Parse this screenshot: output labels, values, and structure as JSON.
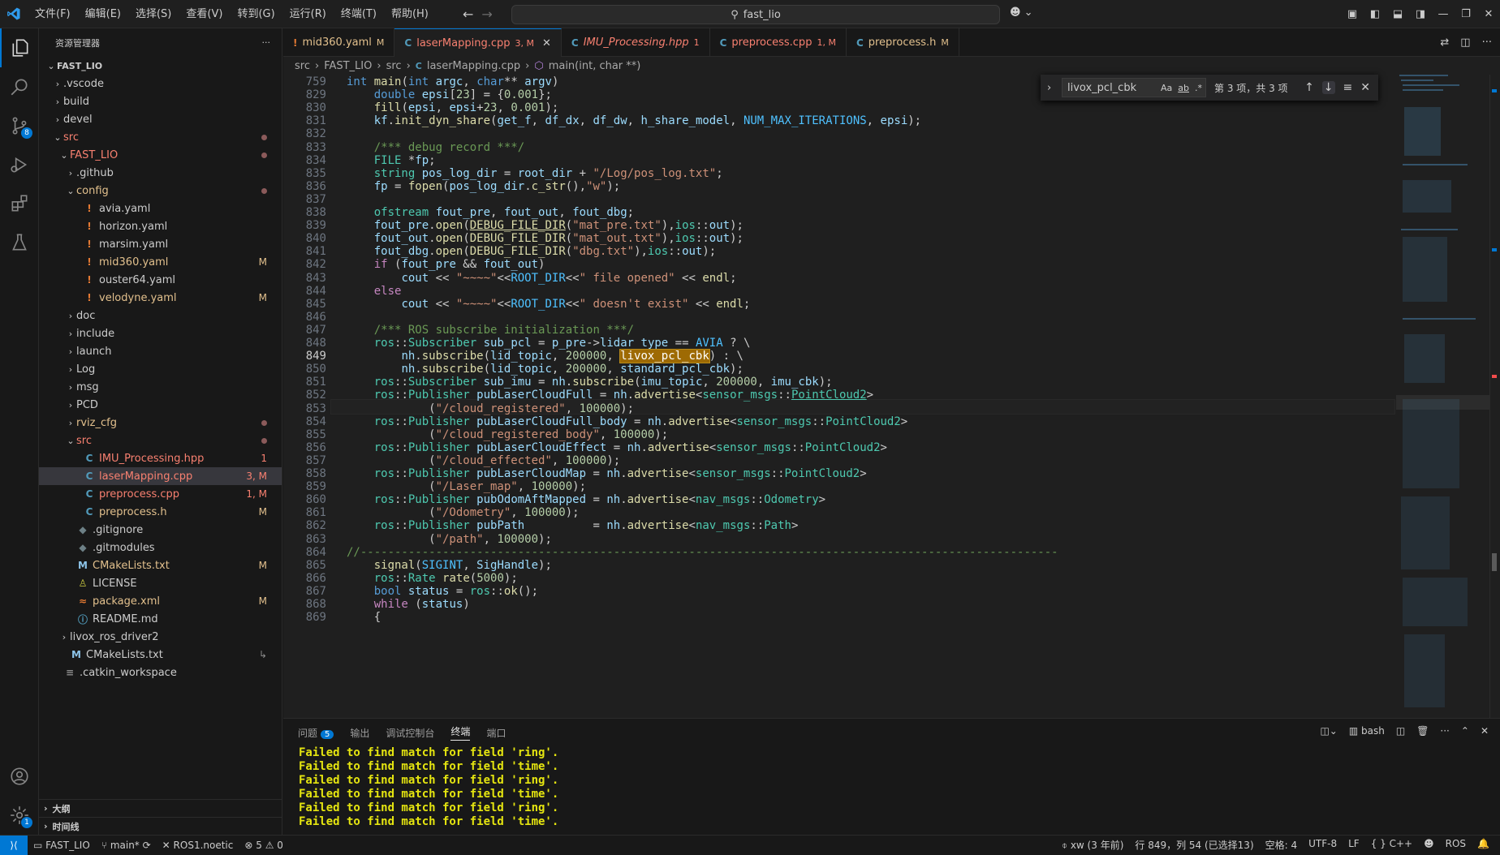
{
  "title_bar": {
    "menu": [
      "文件(F)",
      "编辑(E)",
      "选择(S)",
      "查看(V)",
      "转到(G)",
      "运行(R)",
      "终端(T)",
      "帮助(H)"
    ],
    "search": "fast_lio"
  },
  "activity_bar": {
    "source_control_badge": "8",
    "settings_badge": "1"
  },
  "explorer": {
    "header": "资源管理器",
    "more": "···",
    "rows": [
      {
        "label": "FAST_LIO",
        "indent": 0,
        "chev": "v",
        "icon": "",
        "status": "",
        "cls": "",
        "bold": true
      },
      {
        "label": ".vscode",
        "indent": 1,
        "chev": ">",
        "icon": "",
        "status": "",
        "cls": ""
      },
      {
        "label": "build",
        "indent": 1,
        "chev": ">",
        "icon": "",
        "status": "",
        "cls": ""
      },
      {
        "label": "devel",
        "indent": 1,
        "chev": ">",
        "icon": "",
        "status": "",
        "cls": ""
      },
      {
        "label": "src",
        "indent": 1,
        "chev": "v",
        "icon": "",
        "status": "",
        "cls": "err",
        "dot": true
      },
      {
        "label": "FAST_LIO",
        "indent": 2,
        "chev": "v",
        "icon": "",
        "status": "",
        "cls": "err",
        "dot": true
      },
      {
        "label": ".github",
        "indent": 3,
        "chev": ">",
        "icon": "",
        "status": "",
        "cls": ""
      },
      {
        "label": "config",
        "indent": 3,
        "chev": "v",
        "icon": "",
        "status": "",
        "cls": "mod",
        "dot": true
      },
      {
        "label": "avia.yaml",
        "indent": 4,
        "chev": "",
        "icon": "!",
        "status": "",
        "cls": ""
      },
      {
        "label": "horizon.yaml",
        "indent": 4,
        "chev": "",
        "icon": "!",
        "status": "",
        "cls": ""
      },
      {
        "label": "marsim.yaml",
        "indent": 4,
        "chev": "",
        "icon": "!",
        "status": "",
        "cls": ""
      },
      {
        "label": "mid360.yaml",
        "indent": 4,
        "chev": "",
        "icon": "!",
        "status": "M",
        "cls": "mod"
      },
      {
        "label": "ouster64.yaml",
        "indent": 4,
        "chev": "",
        "icon": "!",
        "status": "",
        "cls": ""
      },
      {
        "label": "velodyne.yaml",
        "indent": 4,
        "chev": "",
        "icon": "!",
        "status": "M",
        "cls": "mod"
      },
      {
        "label": "doc",
        "indent": 3,
        "chev": ">",
        "icon": "",
        "status": "",
        "cls": ""
      },
      {
        "label": "include",
        "indent": 3,
        "chev": ">",
        "icon": "",
        "status": "",
        "cls": ""
      },
      {
        "label": "launch",
        "indent": 3,
        "chev": ">",
        "icon": "",
        "status": "",
        "cls": ""
      },
      {
        "label": "Log",
        "indent": 3,
        "chev": ">",
        "icon": "",
        "status": "",
        "cls": ""
      },
      {
        "label": "msg",
        "indent": 3,
        "chev": ">",
        "icon": "",
        "status": "",
        "cls": ""
      },
      {
        "label": "PCD",
        "indent": 3,
        "chev": ">",
        "icon": "",
        "status": "",
        "cls": ""
      },
      {
        "label": "rviz_cfg",
        "indent": 3,
        "chev": ">",
        "icon": "",
        "status": "",
        "cls": "mod",
        "dot": true
      },
      {
        "label": "src",
        "indent": 3,
        "chev": "v",
        "icon": "",
        "status": "",
        "cls": "err",
        "dot": true
      },
      {
        "label": "IMU_Processing.hpp",
        "indent": 4,
        "chev": "",
        "icon": "C",
        "status": "1",
        "cls": "err"
      },
      {
        "label": "laserMapping.cpp",
        "indent": 4,
        "chev": "",
        "icon": "C",
        "status": "3, M",
        "cls": "err",
        "sel": true
      },
      {
        "label": "preprocess.cpp",
        "indent": 4,
        "chev": "",
        "icon": "C",
        "status": "1, M",
        "cls": "err"
      },
      {
        "label": "preprocess.h",
        "indent": 4,
        "chev": "",
        "icon": "C",
        "status": "M",
        "cls": "mod"
      },
      {
        "label": ".gitignore",
        "indent": 3,
        "chev": "",
        "icon": "◆",
        "status": "",
        "cls": ""
      },
      {
        "label": ".gitmodules",
        "indent": 3,
        "chev": "",
        "icon": "◆",
        "status": "",
        "cls": ""
      },
      {
        "label": "CMakeLists.txt",
        "indent": 3,
        "chev": "",
        "icon": "M",
        "status": "M",
        "cls": "mod"
      },
      {
        "label": "LICENSE",
        "indent": 3,
        "chev": "",
        "icon": "♙",
        "status": "",
        "cls": ""
      },
      {
        "label": "package.xml",
        "indent": 3,
        "chev": "",
        "icon": "≈",
        "status": "M",
        "cls": "mod"
      },
      {
        "label": "README.md",
        "indent": 3,
        "chev": "",
        "icon": "ⓘ",
        "status": "",
        "cls": ""
      },
      {
        "label": "livox_ros_driver2",
        "indent": 2,
        "chev": ">",
        "icon": "",
        "status": "",
        "cls": ""
      },
      {
        "label": "CMakeLists.txt",
        "indent": 2,
        "chev": "",
        "icon": "M",
        "status": "↳",
        "cls": ""
      },
      {
        "label": ".catkin_workspace",
        "indent": 1,
        "chev": "",
        "icon": "≡",
        "status": "",
        "cls": ""
      }
    ],
    "outline": "大纲",
    "timeline": "时间线"
  },
  "tabs": [
    {
      "label": "mid360.yaml",
      "status": "M",
      "icon": "!",
      "cls": "mod",
      "italic": false
    },
    {
      "label": "laserMapping.cpp",
      "status": "3, M",
      "icon": "C",
      "cls": "err",
      "italic": false,
      "active": true
    },
    {
      "label": "IMU_Processing.hpp",
      "status": "1",
      "icon": "C",
      "cls": "err",
      "italic": true
    },
    {
      "label": "preprocess.cpp",
      "status": "1, M",
      "icon": "C",
      "cls": "err",
      "italic": false
    },
    {
      "label": "preprocess.h",
      "status": "M",
      "icon": "C",
      "cls": "mod",
      "italic": false
    }
  ],
  "breadcrumb": [
    "src",
    "FAST_LIO",
    "src",
    "laserMapping.cpp",
    "main(int, char **)"
  ],
  "find": {
    "query": "livox_pcl_cbk",
    "opt_case": "Aa",
    "opt_word": "ab",
    "opt_regex": ".*",
    "result": "第 3 项，共 3 项"
  },
  "editor": {
    "current_line": "849",
    "highlight": "livox_pcl_cbk",
    "lines": [
      {
        "n": "759",
        "html": "<span class='k'>int</span> <span class='f'>main</span>(<span class='k'>int</span> <span class='v'>argc</span>, <span class='k'>char</span>** <span class='v'>argv</span>)"
      },
      {
        "n": "829",
        "html": "    <span class='k'>double</span> <span class='v'>epsi</span>[<span class='n'>23</span>] = {<span class='n'>0.001</span>};"
      },
      {
        "n": "830",
        "html": "    <span class='f'>fill</span>(<span class='v'>epsi</span>, <span class='v'>epsi</span>+<span class='n'>23</span>, <span class='n'>0.001</span>);"
      },
      {
        "n": "831",
        "html": "    <span class='v'>kf</span>.<span class='f'>init_dyn_share</span>(<span class='v'>get_f</span>, <span class='v'>df_dx</span>, <span class='v'>df_dw</span>, <span class='v'>h_share_model</span>, <span class='m'>NUM_MAX_ITERATIONS</span>, <span class='v'>epsi</span>);"
      },
      {
        "n": "832",
        "html": ""
      },
      {
        "n": "833",
        "html": "    <span class='c'>/*** debug record ***/</span>"
      },
      {
        "n": "834",
        "html": "    <span class='t'>FILE</span> *<span class='v'>fp</span>;"
      },
      {
        "n": "835",
        "html": "    <span class='t'>string</span> <span class='v'>pos_log_dir</span> = <span class='v'>root_dir</span> + <span class='s'>\"/Log/pos_log.txt\"</span>;"
      },
      {
        "n": "836",
        "html": "    <span class='v'>fp</span> = <span class='f'>fopen</span>(<span class='v'>pos_log_dir</span>.<span class='f'>c_str</span>(),<span class='s'>\"w\"</span>);"
      },
      {
        "n": "837",
        "html": ""
      },
      {
        "n": "838",
        "html": "    <span class='t'>ofstream</span> <span class='v'>fout_pre</span>, <span class='v'>fout_out</span>, <span class='v'>fout_dbg</span>;"
      },
      {
        "n": "839",
        "html": "    <span class='v'>fout_pre</span>.<span class='f'>open</span>(<span class='f ul'>DEBUG_FILE_DIR</span>(<span class='s'>\"mat_pre.txt\"</span>),<span class='t'>ios</span>::<span class='v'>out</span>);"
      },
      {
        "n": "840",
        "html": "    <span class='v'>fout_out</span>.<span class='f'>open</span>(<span class='f'>DEBUG_FILE_DIR</span>(<span class='s'>\"mat_out.txt\"</span>),<span class='t'>ios</span>::<span class='v'>out</span>);"
      },
      {
        "n": "841",
        "html": "    <span class='v'>fout_dbg</span>.<span class='f'>open</span>(<span class='f'>DEBUG_FILE_DIR</span>(<span class='s'>\"dbg.txt\"</span>),<span class='t'>ios</span>::<span class='v'>out</span>);"
      },
      {
        "n": "842",
        "html": "    <span class='e'>if</span> (<span class='v'>fout_pre</span> &amp;&amp; <span class='v'>fout_out</span>)"
      },
      {
        "n": "843",
        "html": "        <span class='v'>cout</span> &lt;&lt; <span class='s'>\"~~~~\"</span>&lt;&lt;<span class='m'>ROOT_DIR</span>&lt;&lt;<span class='s'>\" file opened\"</span> &lt;&lt; <span class='f'>endl</span>;"
      },
      {
        "n": "844",
        "html": "    <span class='e'>else</span>"
      },
      {
        "n": "845",
        "html": "        <span class='v'>cout</span> &lt;&lt; <span class='s'>\"~~~~\"</span>&lt;&lt;<span class='m'>ROOT_DIR</span>&lt;&lt;<span class='s'>\" doesn't exist\"</span> &lt;&lt; <span class='f'>endl</span>;"
      },
      {
        "n": "846",
        "html": ""
      },
      {
        "n": "847",
        "html": "    <span class='c'>/*** ROS subscribe initialization ***/</span>"
      },
      {
        "n": "848",
        "html": "    <span class='t'>ros</span>::<span class='t'>Subscriber</span> <span class='v'>sub_pcl</span> = <span class='v'>p_pre</span>-&gt;<span class='v'>lidar_type</span> == <span class='m'>AVIA</span> ? \\"
      },
      {
        "n": "849",
        "html": "        <span class='v'>nh</span>.<span class='f'>subscribe</span>(<span class='v'>lid_topic</span>, <span class='n'>200000</span>, <span class='hl'>livox_pcl_cbk</span>) : \\"
      },
      {
        "n": "850",
        "html": "        <span class='v'>nh</span>.<span class='f'>subscribe</span>(<span class='v'>lid_topic</span>, <span class='n'>200000</span>, <span class='v'>standard_pcl_cbk</span>);"
      },
      {
        "n": "851",
        "html": "    <span class='t'>ros</span>::<span class='t'>Subscriber</span> <span class='v'>sub_imu</span> = <span class='v'>nh</span>.<span class='f'>subscribe</span>(<span class='v'>imu_topic</span>, <span class='n'>200000</span>, <span class='v'>imu_cbk</span>);"
      },
      {
        "n": "852",
        "html": "    <span class='t'>ros</span>::<span class='t'>Publisher</span> <span class='v'>pubLaserCloudFull</span> = <span class='v'>nh</span>.<span class='f'>advertise</span>&lt;<span class='t'>sensor_msgs</span>::<span class='t ul'>PointCloud2</span>&gt;"
      },
      {
        "n": "853",
        "html": "            (<span class='s'>\"/cloud_registered\"</span>, <span class='n'>100000</span>);"
      },
      {
        "n": "854",
        "html": "    <span class='t'>ros</span>::<span class='t'>Publisher</span> <span class='v'>pubLaserCloudFull_body</span> = <span class='v'>nh</span>.<span class='f'>advertise</span>&lt;<span class='t'>sensor_msgs</span>::<span class='t'>PointCloud2</span>&gt;"
      },
      {
        "n": "855",
        "html": "            (<span class='s'>\"/cloud_registered_body\"</span>, <span class='n'>100000</span>);"
      },
      {
        "n": "856",
        "html": "    <span class='t'>ros</span>::<span class='t'>Publisher</span> <span class='v'>pubLaserCloudEffect</span> = <span class='v'>nh</span>.<span class='f'>advertise</span>&lt;<span class='t'>sensor_msgs</span>::<span class='t'>PointCloud2</span>&gt;"
      },
      {
        "n": "857",
        "html": "            (<span class='s'>\"/cloud_effected\"</span>, <span class='n'>100000</span>);"
      },
      {
        "n": "858",
        "html": "    <span class='t'>ros</span>::<span class='t'>Publisher</span> <span class='v'>pubLaserCloudMap</span> = <span class='v'>nh</span>.<span class='f'>advertise</span>&lt;<span class='t'>sensor_msgs</span>::<span class='t'>PointCloud2</span>&gt;"
      },
      {
        "n": "859",
        "html": "            (<span class='s'>\"/Laser_map\"</span>, <span class='n'>100000</span>);"
      },
      {
        "n": "860",
        "html": "    <span class='t'>ros</span>::<span class='t'>Publisher</span> <span class='v'>pubOdomAftMapped</span> = <span class='v'>nh</span>.<span class='f'>advertise</span>&lt;<span class='t'>nav_msgs</span>::<span class='t'>Odometry</span>&gt;"
      },
      {
        "n": "861",
        "html": "            (<span class='s'>\"/Odometry\"</span>, <span class='n'>100000</span>);"
      },
      {
        "n": "862",
        "html": "    <span class='t'>ros</span>::<span class='t'>Publisher</span> <span class='v'>pubPath</span>          = <span class='v'>nh</span>.<span class='f'>advertise</span>&lt;<span class='t'>nav_msgs</span>::<span class='t'>Path</span>&gt;"
      },
      {
        "n": "863",
        "html": "            (<span class='s'>\"/path\"</span>, <span class='n'>100000</span>);"
      },
      {
        "n": "864",
        "html": "<span class='c'>//------------------------------------------------------------------------------------------------------</span>"
      },
      {
        "n": "865",
        "html": "    <span class='f'>signal</span>(<span class='m'>SIGINT</span>, <span class='v'>SigHandle</span>);"
      },
      {
        "n": "866",
        "html": "    <span class='t'>ros</span>::<span class='t'>Rate</span> <span class='f'>rate</span>(<span class='n'>5000</span>);"
      },
      {
        "n": "867",
        "html": "    <span class='k'>bool</span> <span class='v'>status</span> = <span class='t'>ros</span>::<span class='f'>ok</span>();"
      },
      {
        "n": "868",
        "html": "    <span class='e'>while</span> (<span class='v'>status</span>)"
      },
      {
        "n": "869",
        "html": "    {"
      }
    ]
  },
  "panel": {
    "tabs": [
      "问题",
      "输出",
      "调试控制台",
      "终端",
      "端口"
    ],
    "problems_count": "5",
    "active_tab": "终端",
    "shell": "bash",
    "terminal_lines": [
      "Failed to find match for field 'ring'.",
      "Failed to find match for field 'time'.",
      "Failed to find match for field 'ring'.",
      "Failed to find match for field 'time'.",
      "Failed to find match for field 'ring'.",
      "Failed to find match for field 'time'."
    ]
  },
  "status_bar": {
    "folder": "FAST_LIO",
    "branch": "main*",
    "ros": "ROS1.noetic",
    "errors": "5",
    "warnings": "0",
    "blame": "xw (3 年前)",
    "position": "行 849，列 54 (已选择13)",
    "spaces": "空格: 4",
    "encoding": "UTF-8",
    "eol": "LF",
    "language": "C++",
    "ros_label": "ROS"
  },
  "colors": {
    "accent": "#0078d4",
    "modified": "#e2c08d",
    "error": "#f88070",
    "terminal_text": "#e5e510"
  }
}
